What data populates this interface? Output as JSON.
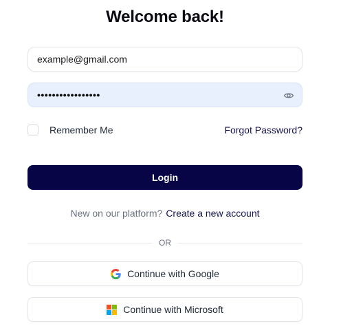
{
  "header": {
    "title": "Welcome back!"
  },
  "form": {
    "email_value": "example@gmail.com",
    "password_masked": "•••••••••••••••••",
    "remember_label": "Remember Me",
    "forgot_label": "Forgot Password?",
    "login_label": "Login"
  },
  "signup": {
    "prompt": "New on our platform?",
    "link": "Create a new account"
  },
  "divider": {
    "text": "OR"
  },
  "social": {
    "google_label": "Continue with Google",
    "microsoft_label": "Continue with Microsoft",
    "google_icon": "google-logo-icon",
    "microsoft_icon": "microsoft-logo-icon"
  },
  "colors": {
    "primary": "#070545",
    "link": "#14134d",
    "autofill_bg": "#e8f0fe"
  }
}
